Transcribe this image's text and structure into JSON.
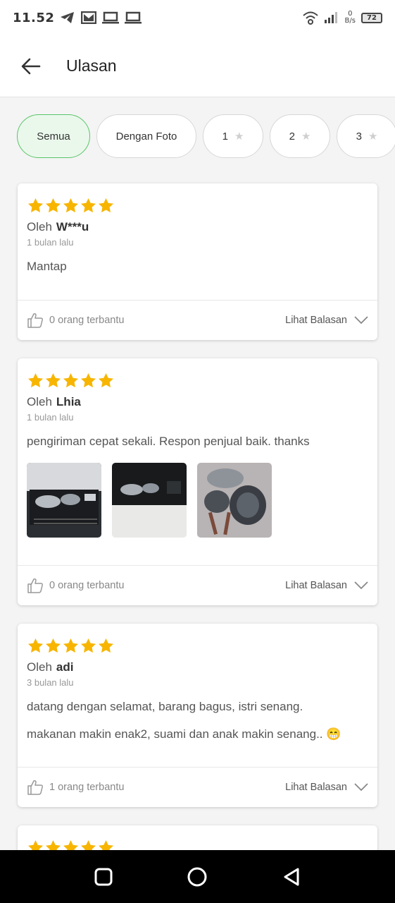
{
  "status_bar": {
    "time": "11.52",
    "net_speed_value": "0",
    "net_speed_unit": "B/s",
    "battery": "72",
    "icons": [
      "telegram-icon",
      "gmail-icon",
      "laptop-icon",
      "laptop-icon",
      "wifi-icon",
      "signal-icon"
    ]
  },
  "header": {
    "title": "Ulasan",
    "back_icon": "arrow-left-icon"
  },
  "filters": [
    {
      "label": "Semua",
      "active": true
    },
    {
      "label": "Dengan Foto",
      "active": false
    },
    {
      "label": "1",
      "star": "★",
      "active": false
    },
    {
      "label": "2",
      "star": "★",
      "active": false
    },
    {
      "label": "3",
      "star": "★",
      "active": false
    }
  ],
  "reviews": [
    {
      "rating": 5,
      "by_label": "Oleh",
      "author": "W***u",
      "date": "1 bulan lalu",
      "text": "Mantap",
      "helpful": "0 orang terbantu",
      "reply_label": "Lihat Balasan"
    },
    {
      "rating": 5,
      "by_label": "Oleh",
      "author": "Lhia",
      "date": "1 bulan lalu",
      "text": "pengiriman cepat sekali. Respon penjual baik. thanks",
      "photos": 3,
      "helpful": "0 orang terbantu",
      "reply_label": "Lihat Balasan"
    },
    {
      "rating": 5,
      "by_label": "Oleh",
      "author": "adi",
      "date": "3 bulan lalu",
      "text_line1": "datang dengan selamat, barang bagus, istri senang.",
      "text_line2": "makanan makin enak2, suami dan anak makin senang.. 😁",
      "helpful": "1 orang terbantu",
      "reply_label": "Lihat Balasan"
    }
  ],
  "colors": {
    "star": "#f7b500",
    "active_chip_bg": "#eaf8ec",
    "active_chip_border": "#58c467"
  }
}
